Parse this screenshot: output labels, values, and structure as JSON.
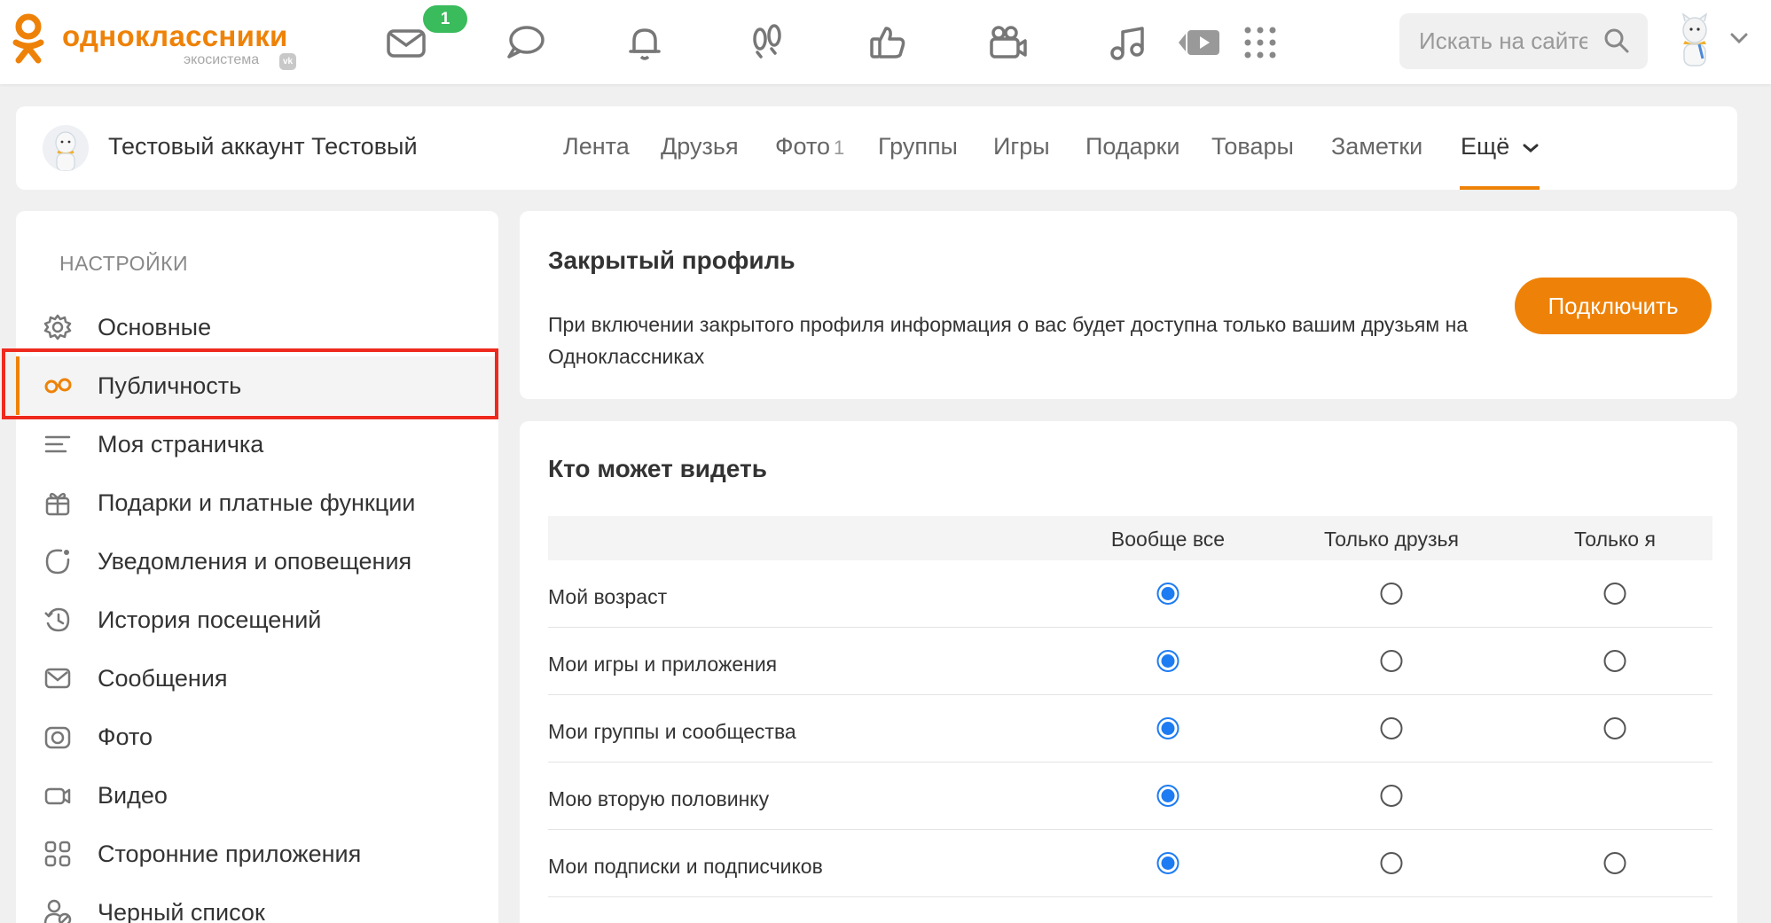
{
  "header": {
    "logo_title": "одноклассники",
    "logo_sub": "экосистема",
    "vk_badge": "vk",
    "messages_badge": "1",
    "search_placeholder": "Искать на сайте",
    "icons": [
      "messages-icon",
      "discussions-icon",
      "notifications-icon",
      "guests-icon",
      "likes-icon",
      "video-icon",
      "music-icon",
      "videoplayer-icon",
      "apps-grid-icon"
    ]
  },
  "profile": {
    "name": "Тестовый аккаунт Тестовый",
    "tabs": [
      {
        "label": "Лента",
        "count": ""
      },
      {
        "label": "Друзья",
        "count": ""
      },
      {
        "label": "Фото",
        "count": "1"
      },
      {
        "label": "Группы",
        "count": ""
      },
      {
        "label": "Игры",
        "count": ""
      },
      {
        "label": "Подарки",
        "count": ""
      },
      {
        "label": "Товары",
        "count": ""
      },
      {
        "label": "Заметки",
        "count": ""
      },
      {
        "label": "Ещё",
        "count": ""
      }
    ],
    "active_tab": "Ещё"
  },
  "sidebar": {
    "heading": "НАСТРОЙКИ",
    "items": [
      {
        "label": "Основные",
        "icon": "gear-icon"
      },
      {
        "label": "Публичность",
        "icon": "glasses-icon",
        "active": true
      },
      {
        "label": "Моя страничка",
        "icon": "lines-icon"
      },
      {
        "label": "Подарки и платные функции",
        "icon": "gift-icon"
      },
      {
        "label": "Уведомления и оповещения",
        "icon": "notification-circle-icon"
      },
      {
        "label": "История посещений",
        "icon": "history-icon"
      },
      {
        "label": "Сообщения",
        "icon": "envelope-icon"
      },
      {
        "label": "Фото",
        "icon": "camera-icon"
      },
      {
        "label": "Видео",
        "icon": "video-camera-icon"
      },
      {
        "label": "Сторонние приложения",
        "icon": "apps-icon"
      },
      {
        "label": "Черный список",
        "icon": "blocked-user-icon"
      }
    ]
  },
  "closed_profile": {
    "title": "Закрытый профиль",
    "description": "При включении закрытого профиля информация о вас будет доступна только вашим друзьям на Одноклассниках",
    "button": "Подключить"
  },
  "visibility": {
    "title": "Кто может видеть",
    "columns": [
      "Вообще все",
      "Только друзья",
      "Только я"
    ],
    "rows": [
      {
        "label": "Мой возраст",
        "selected": 0,
        "options": 3
      },
      {
        "label": "Мои игры и приложения",
        "selected": 0,
        "options": 3
      },
      {
        "label": "Мои группы и сообщества",
        "selected": 0,
        "options": 3
      },
      {
        "label": "Мою вторую половинку",
        "selected": 0,
        "options": 2
      },
      {
        "label": "Мои подписки и подписчиков",
        "selected": 0,
        "options": 3
      }
    ]
  },
  "colors": {
    "brand": "#ee8208",
    "radio_selected": "#1e7cf2",
    "badge_green": "#3abb5c",
    "highlight_red": "#ee2a1e"
  }
}
